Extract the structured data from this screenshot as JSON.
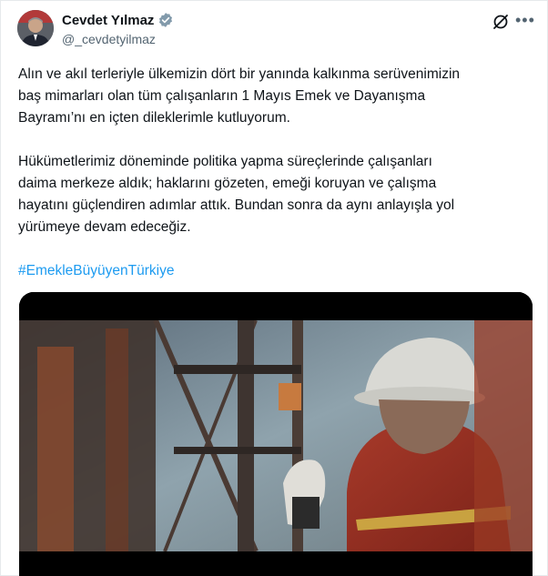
{
  "author": {
    "name": "Cevdet Yılmaz",
    "handle": "@_cevdetyilmaz"
  },
  "icons": {
    "verified": "verified-badge-icon",
    "grok": "grok-icon",
    "more": "more-icon"
  },
  "colors": {
    "link": "#1d9bf0",
    "verified": "#829aab"
  },
  "post": {
    "paragraph1": "Alın ve akıl terleriyle ülkemizin dört bir yanında kalkınma serüvenimizin\nbaş mimarları olan tüm çalışanların 1 Mayıs Emek ve Dayanışma\nBayramı’nı en içten dileklerimle kutluyorum.",
    "paragraph2": "Hükümetlerimiz döneminde politika yapma süreçlerinde çalışanları\ndaima merkeze aldık; haklarını gözeten, emeği koruyan ve çalışma\nhayatını güçlendiren adımlar attık. Bundan sonra da aynı anlayışla yol\nyürümeye devam edeceğiz.",
    "hashtag": "#EmekleBüyüyenTürkiye"
  }
}
